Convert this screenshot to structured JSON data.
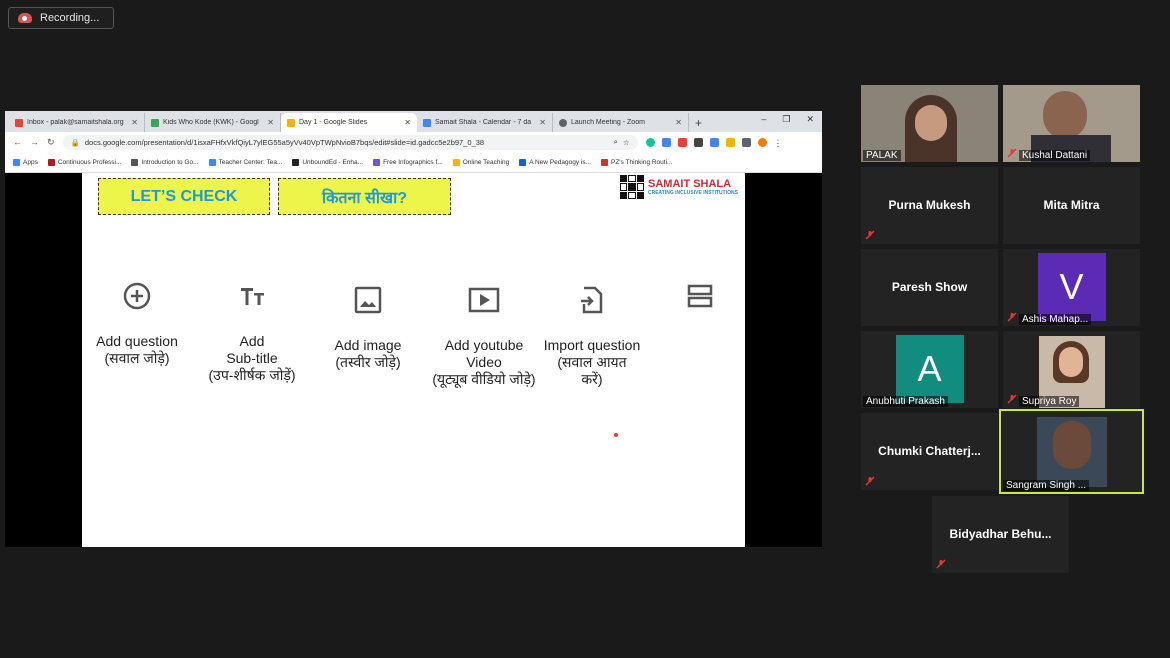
{
  "recording": {
    "label": "Recording..."
  },
  "browser": {
    "tabs": [
      {
        "title": "Inbox - palak@samaitshala.org",
        "fav_color": "#ea4335",
        "active": false
      },
      {
        "title": "Kids Who Kode (KWK) - Googl",
        "fav_color": "#34a853",
        "active": false
      },
      {
        "title": "Day 1 - Google Slides",
        "fav_color": "#f4b400",
        "active": true
      },
      {
        "title": "Samait Shala - Calendar - 7 da",
        "fav_color": "#4285f4",
        "active": false
      },
      {
        "title": "Launch Meeting - Zoom",
        "fav_color": "#5f6368",
        "active": false
      }
    ],
    "new_tab": "+",
    "win_controls": {
      "minimize": "–",
      "restore": "❐",
      "close": "✕"
    },
    "url": "docs.google.com/presentation/d/1isxaFHfxVkfQiyL7ylEG55a5yVv40VpTWpNvioB7bqs/edit#slide=id.gadcc5e2b97_0_38",
    "bookmarks": [
      {
        "label": "Apps",
        "color": "#4285f4"
      },
      {
        "label": "Continuous Professi...",
        "color": "#b31b1b"
      },
      {
        "label": "Introduction to Go...",
        "color": "#555555"
      },
      {
        "label": "Teacher Center: Tea...",
        "color": "#4285f4"
      },
      {
        "label": "UnboundEd - Enha...",
        "color": "#222222"
      },
      {
        "label": "Free Infographics f...",
        "color": "#6a5acd"
      },
      {
        "label": "Online Teaching",
        "color": "#f4b400"
      },
      {
        "label": "A New Pedagogy is...",
        "color": "#1565c0"
      },
      {
        "label": "PZ's Thinking Routi...",
        "color": "#c0392b"
      }
    ]
  },
  "slide": {
    "badge_left": "LET’S CHECK",
    "badge_right": "कितना सीखा?",
    "logo_title": "SAMAIT SHALA",
    "logo_sub": "CREATING INCLUSIVE INSTITUTIONS",
    "options": [
      {
        "icon": "add-circle-icon",
        "line1": "Add question",
        "line2": "(सवाल जोड़े)",
        "line3": ""
      },
      {
        "icon": "text-format-icon",
        "line1": "Add",
        "line2": "Sub-title",
        "line3": "(उप-शीर्षक जोड़ें)"
      },
      {
        "icon": "image-icon",
        "line1": "Add image",
        "line2": "(तस्वीर जोड़े)",
        "line3": ""
      },
      {
        "icon": "video-play-icon",
        "line1": "Add youtube",
        "line2": "Video",
        "line3": "(यूट्यूब वीडियो जोड़े)"
      },
      {
        "icon": "import-icon",
        "line1": "Import question",
        "line2": "(सवाल आयत",
        "line3": "करें)"
      },
      {
        "icon": "section-icon",
        "line1": "",
        "line2": "",
        "line3": ""
      }
    ]
  },
  "participants": [
    {
      "name": "PALAK",
      "video": true,
      "muted": false
    },
    {
      "name": "Kushal Dattani",
      "video": true,
      "muted": true
    },
    {
      "name": "Purna Mukesh",
      "video": false,
      "muted": true
    },
    {
      "name": "Mita Mitra",
      "video": false,
      "muted": false
    },
    {
      "name": "Paresh Show",
      "video": false,
      "muted": false
    },
    {
      "name": "Ashis Mahap...",
      "avatar_letter": "V",
      "avatar_color": "#5b2bb5",
      "muted": true
    },
    {
      "name": "Anubhuti Prakash",
      "avatar_letter": "A",
      "avatar_color": "#128c7e",
      "muted": false
    },
    {
      "name": "Supriya Roy",
      "video": true,
      "muted": true
    },
    {
      "name": "Chumki  Chatterj...",
      "video": false,
      "muted": true
    },
    {
      "name": "Sangram Singh ...",
      "video": true,
      "muted": false,
      "speaking": true
    },
    {
      "name": "Bidyadhar  Behu...",
      "video": false,
      "muted": true
    }
  ]
}
